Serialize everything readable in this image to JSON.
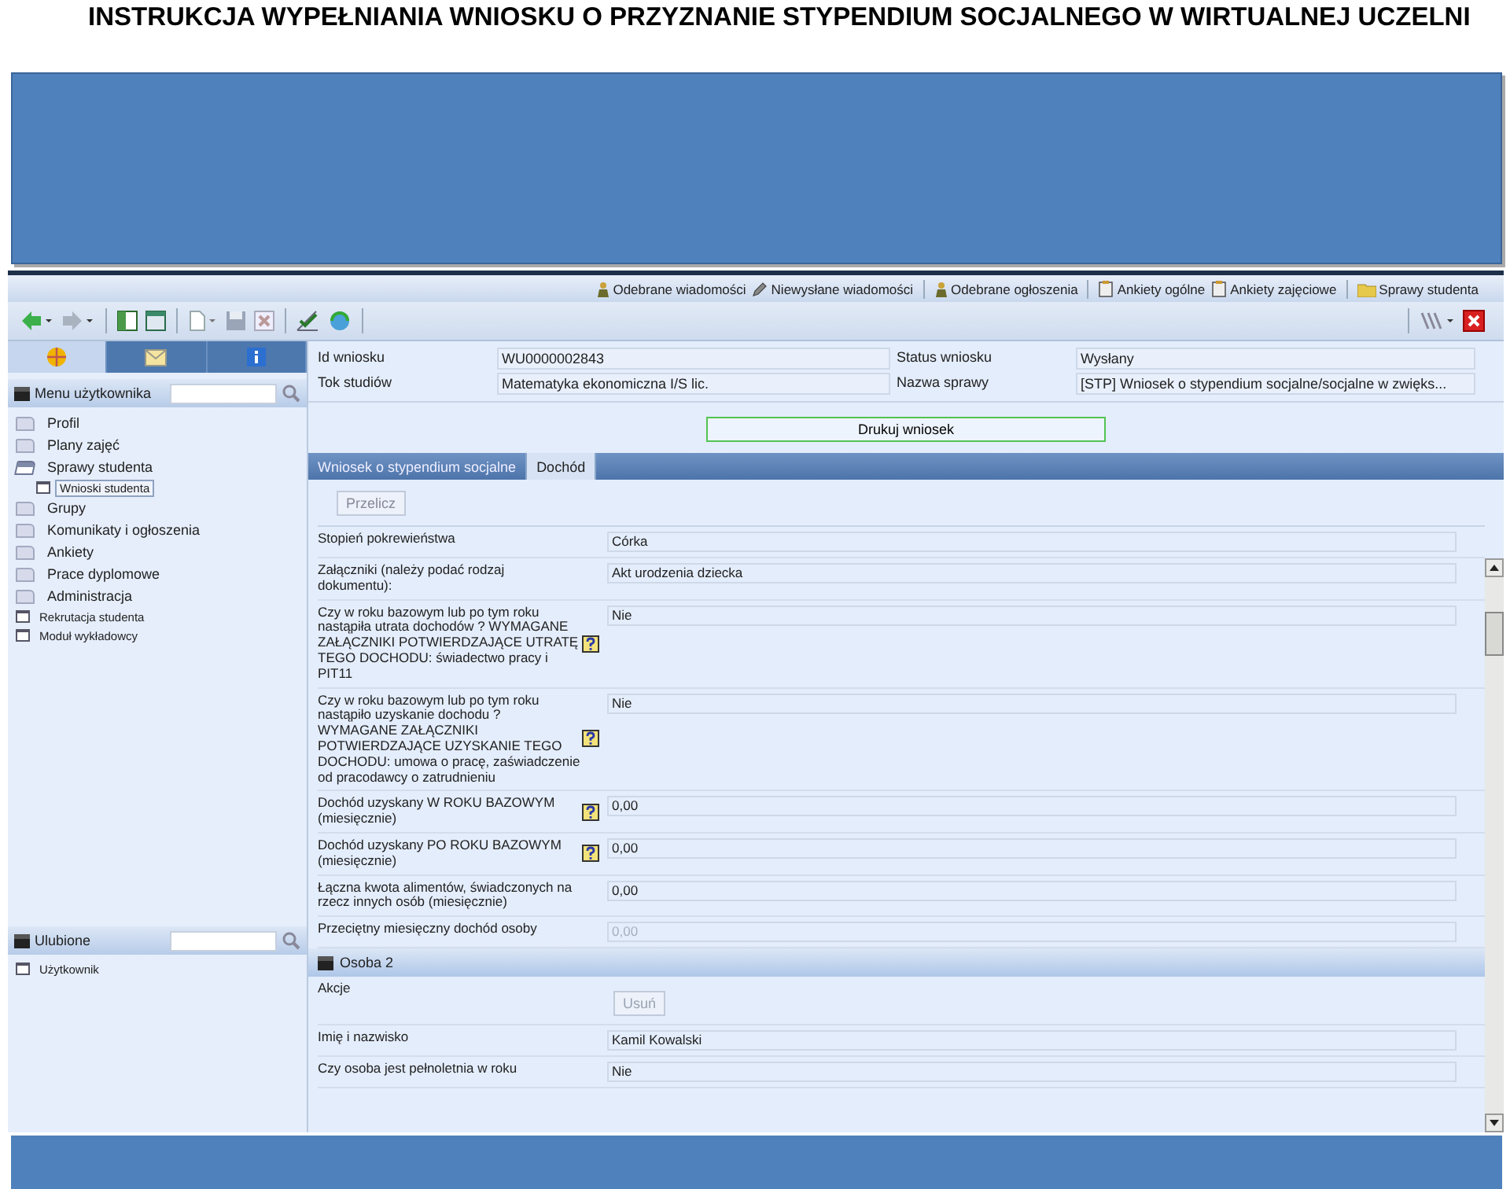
{
  "slide_title": "INSTRUKCJA WYPEŁNIANIA WNIOSKU O PRZYZNANIE STYPENDIUM SOCJALNEGO  W WIRTUALNEJ UCZELNI",
  "top_links": [
    {
      "label": "Odebrane wiadomości"
    },
    {
      "label": "Niewysłane wiadomości"
    },
    {
      "label": "Odebrane ogłoszenia"
    },
    {
      "label": "Ankiety ogólne"
    },
    {
      "label": "Ankiety zajęciowe"
    },
    {
      "label": "Sprawy studenta"
    }
  ],
  "sidebar": {
    "tabs": [
      {
        "selected": true
      },
      {
        "selected": false
      },
      {
        "selected": false
      }
    ],
    "menu_title": "Menu użytkownika",
    "items": [
      {
        "label": "Profil",
        "kind": "folder",
        "selected": false,
        "expanded": false
      },
      {
        "label": "Plany zajęć",
        "kind": "folder",
        "selected": false,
        "expanded": false
      },
      {
        "label": "Sprawy studenta",
        "kind": "folder",
        "selected": false,
        "expanded": true,
        "children": [
          {
            "label": "Wnioski studenta",
            "kind": "page",
            "selected": true
          }
        ]
      },
      {
        "label": "Grupy",
        "kind": "folder",
        "selected": false,
        "expanded": false
      },
      {
        "label": "Komunikaty i ogłoszenia",
        "kind": "folder",
        "selected": false,
        "expanded": false
      },
      {
        "label": "Ankiety",
        "kind": "folder",
        "selected": false,
        "expanded": false
      },
      {
        "label": "Prace dyplomowe",
        "kind": "folder",
        "selected": false,
        "expanded": false
      },
      {
        "label": "Administracja",
        "kind": "folder",
        "selected": false,
        "expanded": false
      },
      {
        "label": "Rekrutacja studenta",
        "kind": "page",
        "selected": false
      },
      {
        "label": "Moduł wykładowcy",
        "kind": "page",
        "selected": false
      }
    ],
    "favorites_title": "Ulubione",
    "favorites": [
      {
        "label": "Użytkownik",
        "kind": "page",
        "selected": false
      }
    ]
  },
  "info": [
    {
      "label": "Id wniosku",
      "value": "WU0000002843"
    },
    {
      "label": "Status wniosku",
      "value": "Wysłany"
    },
    {
      "label": "Tok studiów",
      "value": "Matematyka ekonomiczna I/S lic."
    },
    {
      "label": "Nazwa sprawy",
      "value": "[STP] Wniosek o stypendium socjalne/socjalne w zwięks..."
    }
  ],
  "print_button": "Drukuj wniosek",
  "tabs": [
    {
      "label": "Wniosek o stypendium socjalne",
      "selected": false
    },
    {
      "label": "Dochód",
      "selected": true
    }
  ],
  "recalc_button": "Przelicz",
  "rows": [
    {
      "kind": "field",
      "label": "Stopień pokrewieństwa",
      "value": "Córka",
      "help": false,
      "disabled": false
    },
    {
      "kind": "field",
      "label": "Załączniki (należy podać rodzaj dokumentu):",
      "value": "Akt urodzenia dziecka",
      "help": false,
      "disabled": false
    },
    {
      "kind": "field",
      "label": "Czy w roku bazowym lub po tym roku nastąpiła utrata dochodów ? WYMAGANE ZAŁĄCZNIKI POTWIERDZAJĄCE UTRATĘ TEGO DOCHODU: świadectwo pracy i PIT11",
      "value": "Nie",
      "help": true,
      "disabled": false
    },
    {
      "kind": "field",
      "label": "Czy w roku bazowym lub po tym roku nastąpiło uzyskanie dochodu ? WYMAGANE ZAŁĄCZNIKI POTWIERDZAJĄCE UZYSKANIE TEGO DOCHODU: umowa o pracę, zaświadczenie od pracodawcy o zatrudnieniu",
      "value": "Nie",
      "help": true,
      "disabled": false
    },
    {
      "kind": "field",
      "label": "Dochód uzyskany W ROKU BAZOWYM (miesięcznie)",
      "value": "0,00",
      "help": true,
      "disabled": false
    },
    {
      "kind": "field",
      "label": "Dochód uzyskany PO ROKU BAZOWYM (miesięcznie)",
      "value": "0,00",
      "help": true,
      "disabled": false
    },
    {
      "kind": "field",
      "label": "Łączna kwota alimentów, świadczonych na rzecz innych osób (miesięcznie)",
      "value": "0,00",
      "help": false,
      "disabled": false
    },
    {
      "kind": "field",
      "label": "Przeciętny miesięczny dochód osoby",
      "value": "0,00",
      "help": false,
      "disabled": true
    },
    {
      "kind": "section",
      "label": "Osoba 2"
    },
    {
      "kind": "button",
      "label": "Akcje",
      "value": "Usuń",
      "help": false,
      "disabled": true
    },
    {
      "kind": "field",
      "label": "Imię i nazwisko",
      "value": "Kamil Kowalski",
      "help": false,
      "disabled": false
    },
    {
      "kind": "field",
      "label": "Czy osoba jest pełnoletnia w roku",
      "value": "Nie",
      "help": false,
      "disabled": false
    }
  ]
}
